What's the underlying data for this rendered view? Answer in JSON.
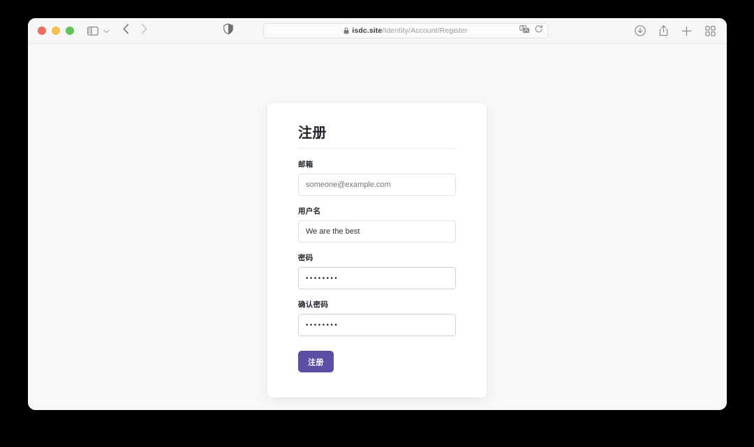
{
  "browser": {
    "window_controls": {
      "close_label": "close",
      "minimize_label": "minimize",
      "maximize_label": "maximize"
    },
    "toolbar": {
      "sidebar_toggle_icon": "sidebar-icon",
      "sidebar_chevron_icon": "chevron-down-icon",
      "back_icon": "chevron-left-icon",
      "forward_icon": "chevron-right-icon",
      "shield_icon": "privacy-shield-icon",
      "translate_icon": "translate-icon",
      "reload_icon": "reload-icon",
      "downloads_icon": "download-icon",
      "share_icon": "share-icon",
      "new_tab_icon": "plus-icon",
      "tab_overview_icon": "grid-icon"
    },
    "address_bar": {
      "lock_icon": "lock-icon",
      "domain": "isdc.site",
      "path": "/Identity/Account/Register"
    }
  },
  "page": {
    "form": {
      "title": "注册",
      "fields": [
        {
          "label": "邮箱",
          "name": "email-field",
          "value": "",
          "placeholder": "someone@example.com",
          "type": "text"
        },
        {
          "label": "用户名",
          "name": "username-field",
          "value": "We are the best",
          "placeholder": "",
          "type": "text"
        },
        {
          "label": "密码",
          "name": "password-field",
          "value": "••••••••",
          "placeholder": "",
          "type": "password"
        },
        {
          "label": "确认密码",
          "name": "confirm-password-field",
          "value": "••••••••",
          "placeholder": "",
          "type": "password"
        }
      ],
      "submit_label": "注册"
    }
  },
  "colors": {
    "accent": "#5a4fa2",
    "page_background": "#f7f8fa",
    "card_background": "#ffffff",
    "text": "#212529",
    "border": "#dee2e6"
  }
}
